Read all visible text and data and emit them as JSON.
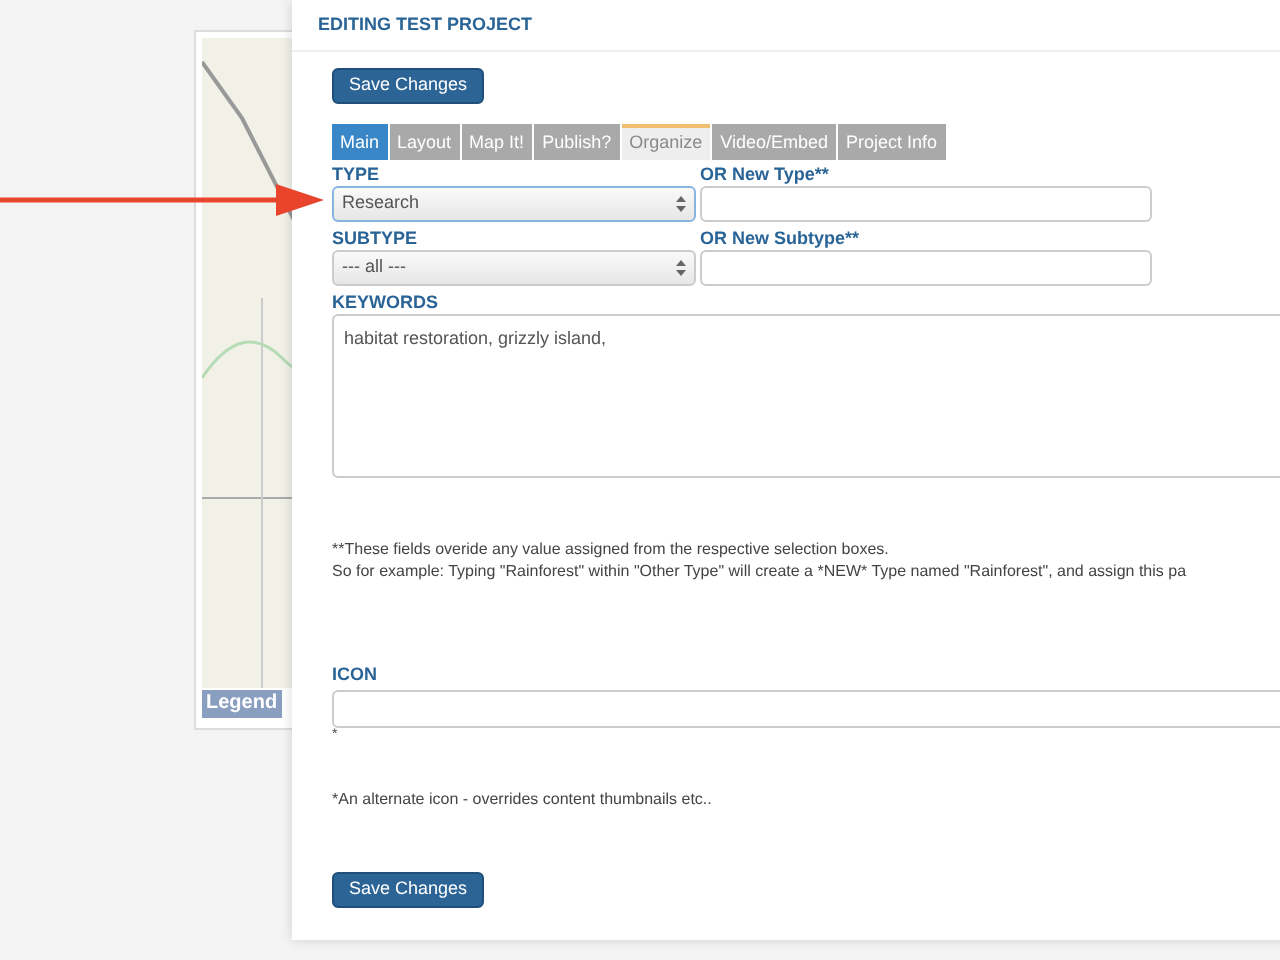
{
  "map": {
    "legend_button": "Legend"
  },
  "dialog": {
    "title": "EDITING TEST PROJECT",
    "save_top": "Save Changes",
    "tabs": [
      {
        "label": "Main",
        "selected": false,
        "active_style": true
      },
      {
        "label": "Layout",
        "selected": false,
        "active_style": false
      },
      {
        "label": "Map It!",
        "selected": false,
        "active_style": false
      },
      {
        "label": "Publish?",
        "selected": false,
        "active_style": false
      },
      {
        "label": "Organize",
        "selected": true,
        "active_style": false
      },
      {
        "label": "Video/Embed",
        "selected": false,
        "active_style": false
      },
      {
        "label": "Project Info",
        "selected": false,
        "active_style": false
      }
    ],
    "type": {
      "label": "TYPE",
      "value": "Research",
      "focused": true
    },
    "new_type": {
      "label": "OR New Type**"
    },
    "subtype": {
      "label": "SUBTYPE",
      "value": "--- all ---",
      "focused": false
    },
    "new_subtype": {
      "label": "OR New Subtype**"
    },
    "keywords": {
      "label": "KEYWORDS",
      "value": "habitat restoration, grizzly island,"
    },
    "footnote_lines": [
      "**These fields overide any value assigned from the respective selection boxes.",
      "So for example: Typing \"Rainforest\" within \"Other Type\" will create a *NEW* Type named \"Rainforest\", and assign this pa"
    ],
    "icon": {
      "label": "ICON",
      "mark": "*"
    },
    "icon_note": "*An alternate icon - overrides content thumbnails etc..",
    "save_bottom": "Save Changes"
  }
}
